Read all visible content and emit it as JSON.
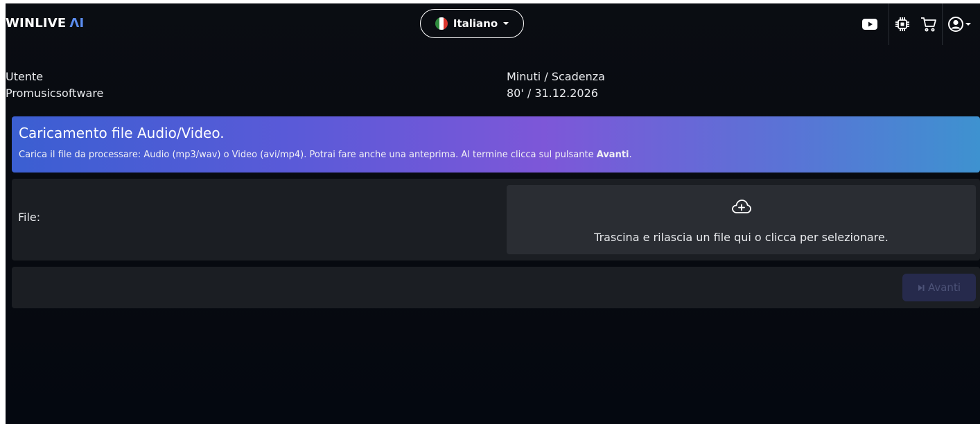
{
  "brand": {
    "name": "WINLIVE",
    "suffix": "ΛI"
  },
  "language": {
    "selected": "Italiano"
  },
  "topbar_icons": [
    "youtube-icon",
    "chip-icon",
    "cart-icon",
    "user-icon"
  ],
  "user": {
    "label": "Utente",
    "value": "Promusicsoftware"
  },
  "plan": {
    "label": "Minuti / Scadenza",
    "value": "80' / 31.12.2026"
  },
  "banner": {
    "title": "Caricamento file Audio/Video.",
    "text": "Carica il file da processare: Audio (mp3/wav) o Video (avi/mp4). Potrai fare anche una anteprima. Al termine clicca sul pulsante ",
    "emphasis": "Avanti",
    "end": "."
  },
  "upload": {
    "label": "File:",
    "dropzone_text": "Trascina e rilascia un file qui o clicca per selezionare."
  },
  "actions": {
    "next_label": "Avanti",
    "next_enabled": false
  },
  "colors": {
    "accent": "#5b8def",
    "banner_start": "#3b5fd2",
    "banner_mid": "#7d57d8",
    "banner_end": "#3e92d0"
  }
}
